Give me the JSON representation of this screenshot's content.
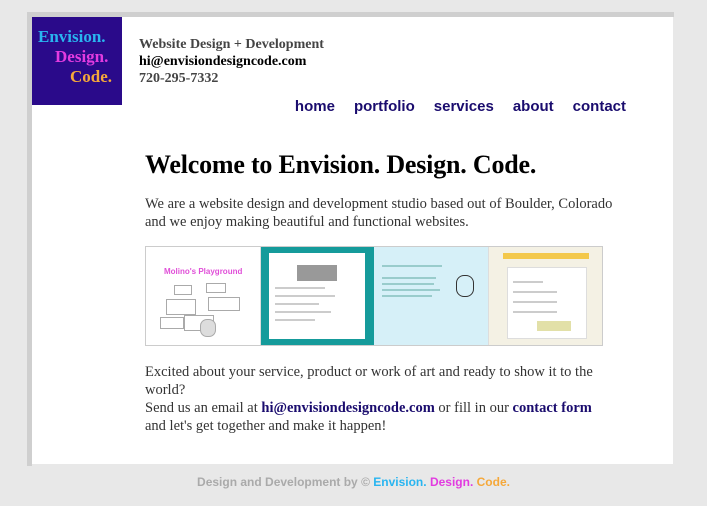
{
  "header": {
    "logo": {
      "line1": "Envision.",
      "line2": "Design.",
      "line3": "Code."
    },
    "tagline": "Website Design + Development",
    "email": "hi@envisiondesigncode.com",
    "phone": "720-295-7332"
  },
  "nav": {
    "items": [
      "home",
      "portfolio",
      "services",
      "about",
      "contact"
    ]
  },
  "main": {
    "title": "Welcome to Envision. Design. Code.",
    "intro": "We are a website design and development studio based out of Boulder, Colorado and we enjoy making beautiful and functional websites.",
    "gallery": {
      "thumb1_title": "Molino's Playground"
    },
    "cta_line1": "Excited about your service, product or work of art and ready to show it to the world?",
    "cta_line2_pre": "Send us an email at ",
    "cta_email": "hi@envisiondesigncode.com",
    "cta_line2_mid": " or fill in our ",
    "cta_contact_link": "contact form",
    "cta_line3": "and let's get together and make it happen!"
  },
  "footer": {
    "prefix": "Design and Development by © ",
    "brand1": "Envision.",
    "brand2": "Design.",
    "brand3": "Code."
  },
  "colors": {
    "logo_bg": "#2a0a8a",
    "brand_blue": "#29b5f0",
    "brand_pink": "#e23be0",
    "brand_orange": "#f5a83a",
    "nav_link": "#1a0c6e"
  }
}
